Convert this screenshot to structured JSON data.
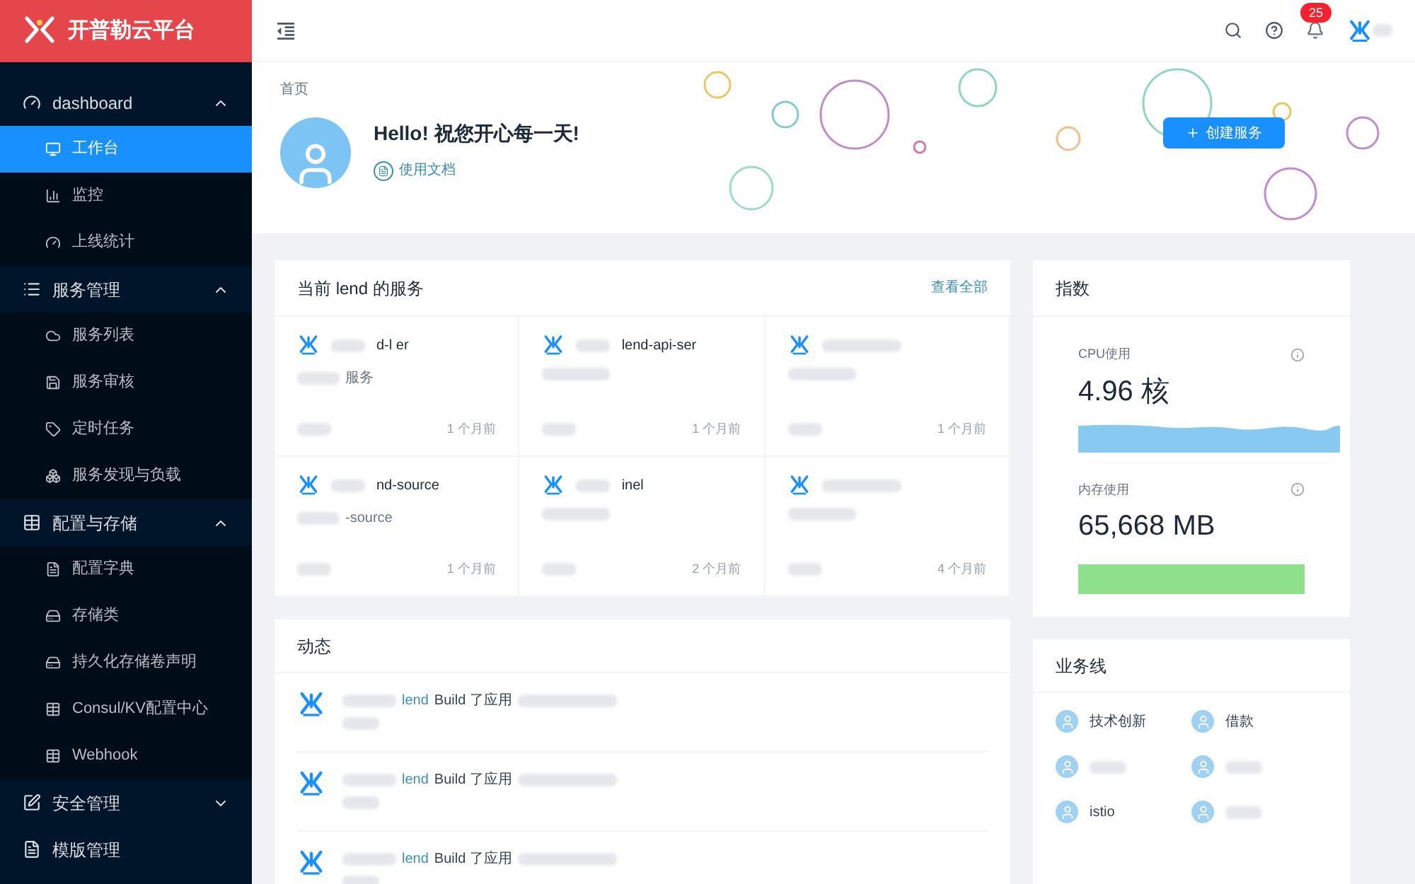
{
  "brand": {
    "title": "开普勒云平台"
  },
  "sidebar": {
    "groups": [
      {
        "label": "dashboard",
        "expanded": true,
        "children": [
          {
            "label": "工作台",
            "selected": true
          },
          {
            "label": "监控",
            "selected": false
          },
          {
            "label": "上线统计",
            "selected": false
          }
        ]
      },
      {
        "label": "服务管理",
        "expanded": true,
        "children": [
          {
            "label": "服务列表",
            "selected": false
          },
          {
            "label": "服务审核",
            "selected": false
          },
          {
            "label": "定时任务",
            "selected": false
          },
          {
            "label": "服务发现与负载",
            "selected": false
          }
        ]
      },
      {
        "label": "配置与存储",
        "expanded": true,
        "children": [
          {
            "label": "配置字典",
            "selected": false
          },
          {
            "label": "存储类",
            "selected": false
          },
          {
            "label": "持久化存储卷声明",
            "selected": false
          },
          {
            "label": "Consul/KV配置中心",
            "selected": false
          },
          {
            "label": "Webhook",
            "selected": false
          }
        ]
      },
      {
        "label": "安全管理",
        "expanded": false
      },
      {
        "label": "模版管理",
        "kind": "link"
      }
    ]
  },
  "header": {
    "notification_count": "25"
  },
  "page_header": {
    "breadcrumb": "首页",
    "greeting_start": "Hello!",
    "greeting_end": "祝您开心每一天!",
    "docs_link": "使用文档",
    "create_button": "创建服务"
  },
  "services": {
    "title": "当前 lend 的服务",
    "view_all": "查看全部",
    "cards": [
      {
        "name": "d-l er",
        "description": "服务",
        "time": "1 个月前"
      },
      {
        "name": "lend-api-ser",
        "time": "1 个月前"
      },
      {
        "time": "1 个月前"
      },
      {
        "name": "nd-source",
        "description": "-source",
        "time": "1 个月前"
      },
      {
        "name": "inel",
        "time": "2 个月前"
      },
      {
        "time": "4 个月前"
      }
    ]
  },
  "activity": {
    "title": "动态",
    "items": [
      {
        "project": "lend",
        "action": "Build 了应用"
      },
      {
        "project": "lend",
        "action": "Build 了应用"
      },
      {
        "project": "lend",
        "action": "Build 了应用"
      }
    ]
  },
  "metrics": {
    "title": "指数",
    "items": [
      {
        "kind": "wave",
        "label": "CPU使用",
        "value": "4.96 核"
      },
      {
        "kind": "bar",
        "label": "内存使用",
        "value": "65,668 MB"
      }
    ]
  },
  "business_lines": {
    "title": "业务线",
    "items": [
      {
        "kind": "named",
        "name": "技术创新"
      },
      {
        "kind": "named",
        "name": "借款"
      },
      {
        "kind": "blurred"
      },
      {
        "kind": "blurred"
      },
      {
        "kind": "named",
        "name": "istio"
      },
      {
        "kind": "blurred"
      }
    ]
  }
}
